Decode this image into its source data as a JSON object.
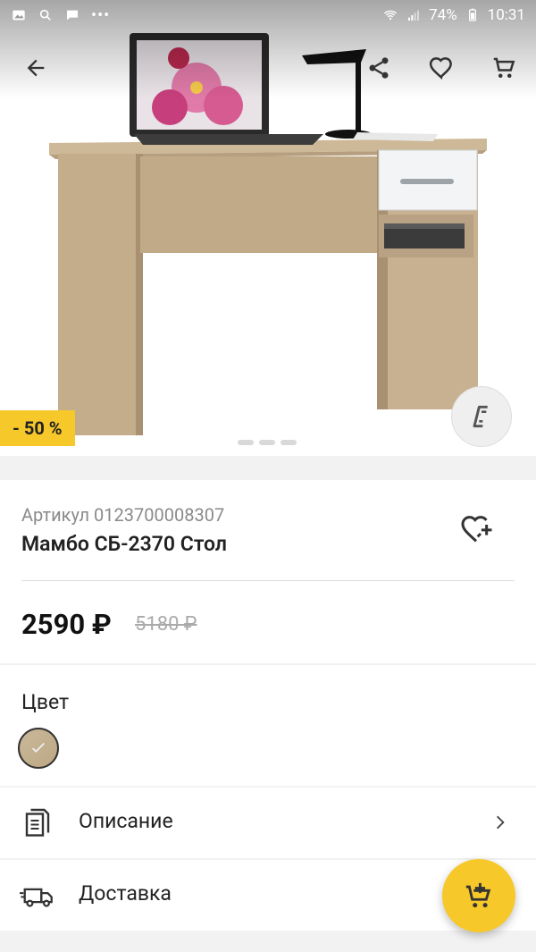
{
  "status_bar": {
    "battery": "74%",
    "time": "10:31"
  },
  "product": {
    "article_label": "Артикул 0123700008307",
    "name": "Мамбо СБ-2370 Стол",
    "price": "2590 ₽",
    "old_price": "5180 ₽",
    "discount_badge": "- 50 %"
  },
  "color_section": {
    "label": "Цвет"
  },
  "rows": {
    "description": "Описание",
    "delivery": "Доставка"
  },
  "gallery": {
    "current_index": 1,
    "count": 3
  },
  "icons": {
    "back": "arrow-left-icon",
    "share": "share-icon",
    "favorite": "heart-icon",
    "cart": "cart-icon",
    "compare": "compare-icon",
    "wishlist_add": "heart-plus-icon",
    "description": "document-icon",
    "delivery": "truck-icon",
    "add_to_cart": "cart-add-icon"
  },
  "colors": {
    "accent": "#f7c82a",
    "swatch": "#c9b89a"
  }
}
